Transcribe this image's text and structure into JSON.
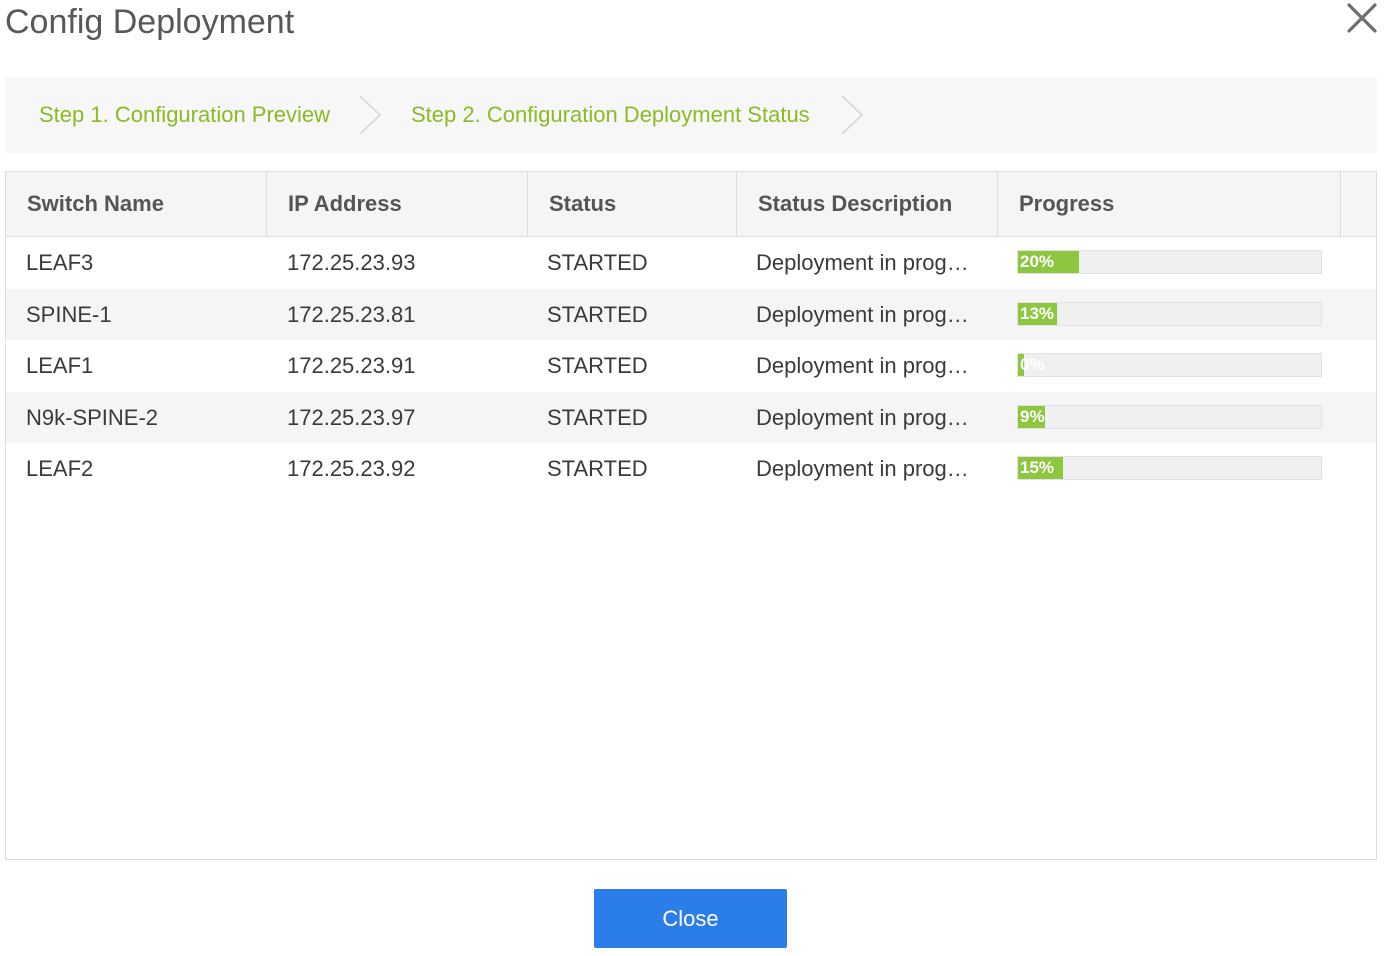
{
  "dialog": {
    "title": "Config Deployment",
    "close_icon": "close-icon"
  },
  "steps": [
    {
      "label": "Step 1. Configuration Preview"
    },
    {
      "label": "Step 2. Configuration Deployment Status"
    }
  ],
  "table": {
    "columns": [
      "Switch Name",
      "IP Address",
      "Status",
      "Status Description",
      "Progress"
    ],
    "rows": [
      {
        "name": "LEAF3",
        "ip": "172.25.23.93",
        "status": "STARTED",
        "description": "Deployment in prog…",
        "progress": 20,
        "progress_label": "20%"
      },
      {
        "name": "SPINE-1",
        "ip": "172.25.23.81",
        "status": "STARTED",
        "description": "Deployment in prog…",
        "progress": 13,
        "progress_label": "13%"
      },
      {
        "name": "LEAF1",
        "ip": "172.25.23.91",
        "status": "STARTED",
        "description": "Deployment in prog…",
        "progress": 0,
        "progress_label": "0%"
      },
      {
        "name": "N9k-SPINE-2",
        "ip": "172.25.23.97",
        "status": "STARTED",
        "description": "Deployment in prog…",
        "progress": 9,
        "progress_label": "9%"
      },
      {
        "name": "LEAF2",
        "ip": "172.25.23.92",
        "status": "STARTED",
        "description": "Deployment in prog…",
        "progress": 15,
        "progress_label": "15%"
      }
    ]
  },
  "footer": {
    "close_label": "Close"
  },
  "colors": {
    "accent": "#8dba24",
    "progress_fill": "#8dc63f",
    "primary_button": "#2b7de9"
  }
}
